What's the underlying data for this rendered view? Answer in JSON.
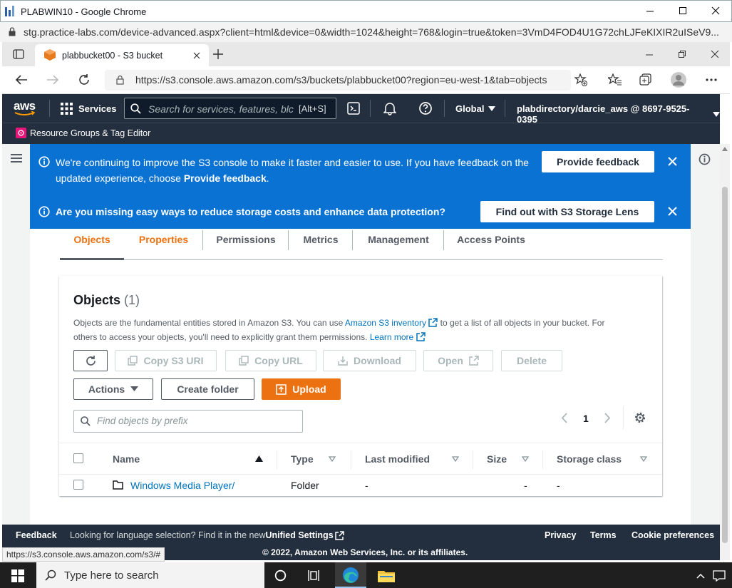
{
  "outer_window": {
    "title": "PLABWIN10 - Google Chrome",
    "url": "stg.practice-labs.com/device-advanced.aspx?client=html&device=0&width=1024&height=768&login=true&token=3VmD4FOD4U1G72chLJFeKIXIR2uISeV9..."
  },
  "browser": {
    "tab_title": "plabbucket00 - S3 bucket",
    "url": "https://s3.console.aws.amazon.com/s3/buckets/plabbucket00?region=eu-west-1&tab=objects"
  },
  "aws_nav": {
    "logo": "aws",
    "services": "Services",
    "search_placeholder": "Search for services, features, blc",
    "search_shortcut": "[Alt+S]",
    "region": "Global",
    "account": "plabdirectory/darcie_aws @ 8697-9525-0395",
    "resource_groups": "Resource Groups & Tag Editor"
  },
  "banners": [
    {
      "text_part1": "We're continuing to improve the S3 console to make it faster and easier to use. If you have feedback on the updated experience, choose ",
      "text_bold": "Provide feedback",
      "text_end": ".",
      "button": "Provide feedback"
    },
    {
      "text": "Are you missing easy ways to reduce storage costs and enhance data protection?",
      "button": "Find out with S3 Storage Lens"
    }
  ],
  "tabs": [
    "Objects",
    "Properties",
    "Permissions",
    "Metrics",
    "Management",
    "Access Points"
  ],
  "objects_panel": {
    "title": "Objects",
    "count": "(1)",
    "desc1": "Objects are the fundamental entities stored in Amazon S3. You can use ",
    "desc_link1": "Amazon S3 inventory",
    "desc2": " to get a list of all objects in your bucket. For",
    "desc3": "others to access your objects, you'll need to explicitly grant them permissions. ",
    "desc_link2": "Learn more",
    "buttons": {
      "copy_s3_uri": "Copy S3 URI",
      "copy_url": "Copy URL",
      "download": "Download",
      "open": "Open",
      "delete": "Delete",
      "actions": "Actions",
      "create_folder": "Create folder",
      "upload": "Upload"
    },
    "filter_placeholder": "Find objects by prefix",
    "page": "1",
    "columns": [
      "Name",
      "Type",
      "Last modified",
      "Size",
      "Storage class"
    ],
    "rows": [
      {
        "name": "Windows Media Player/",
        "type": "Folder",
        "last_modified": "-",
        "size": "-",
        "storage_class": "-"
      }
    ]
  },
  "footer": {
    "feedback": "Feedback",
    "lang_text": "Looking for language selection? Find it in the new ",
    "lang_link": "Unified Settings",
    "privacy": "Privacy",
    "terms": "Terms",
    "cookies": "Cookie preferences",
    "copyright": "© 2022, Amazon Web Services, Inc. or its affiliates."
  },
  "status_url": "https://s3.console.aws.amazon.com/s3/#",
  "taskbar": {
    "search_placeholder": "Type here to search"
  },
  "colors": {
    "aws_nav": "#232f3e",
    "banner_blue": "#0972d3",
    "accent_orange": "#ec7211",
    "link": "#0073bb"
  }
}
